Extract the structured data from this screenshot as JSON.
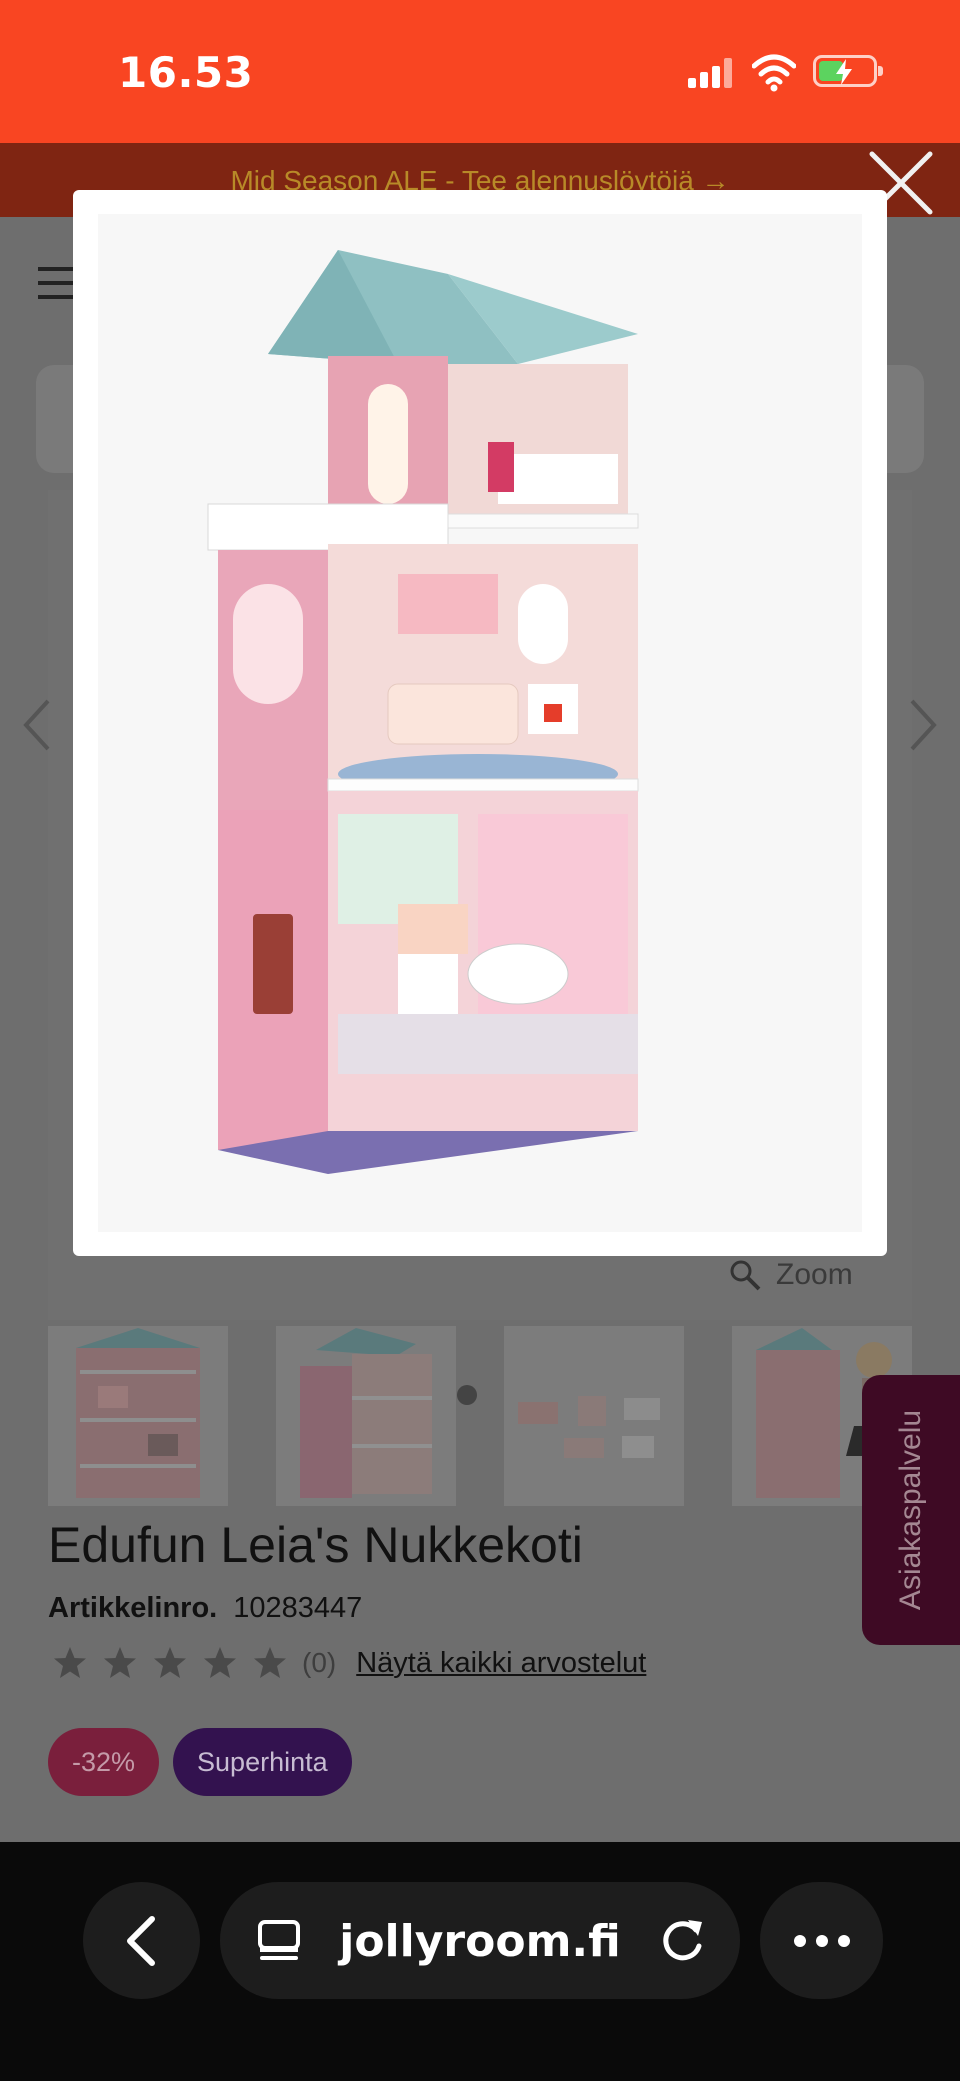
{
  "status_bar": {
    "time": "16.53",
    "icons": [
      "signal-icon",
      "wifi-icon",
      "battery-charging-icon"
    ]
  },
  "promo": {
    "text": "Mid Season ALE - Tee alennuslöytöjä →"
  },
  "gallery": {
    "zoom_label": "Zoom",
    "modal_image": "dollhouse-image",
    "thumbnails": [
      "dollhouse-front-thumbnail",
      "dollhouse-side-thumbnail",
      "furniture-thumbnail",
      "girl-with-dollhouse-thumbnail"
    ]
  },
  "product": {
    "title": "Edufun Leia's Nukkekoti",
    "article_label": "Artikkelinro.",
    "article_number": "10283447",
    "rating": 0,
    "review_count": "(0)",
    "reviews_link": "Näytä kaikki arvostelut",
    "badges": {
      "discount": "-32%",
      "super_price": "Superhinta"
    }
  },
  "customer_service": {
    "label": "Asiakaspalvelu"
  },
  "browser": {
    "url": "jollyroom.fi"
  },
  "colors": {
    "status_bar": "#f94522",
    "discount_badge": "#7a1f3c",
    "super_badge": "#33124f",
    "customer_tab": "#3e0a24"
  }
}
